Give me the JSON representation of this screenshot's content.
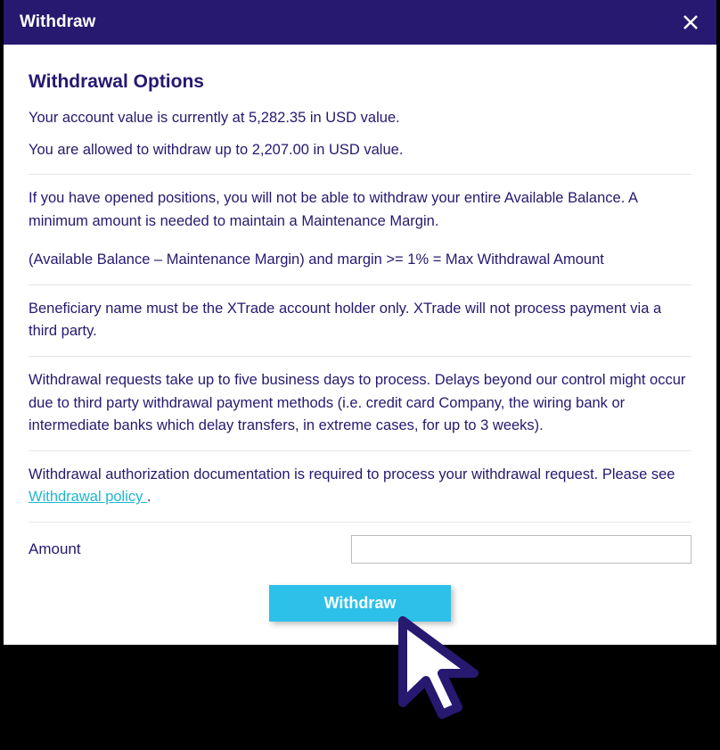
{
  "header": {
    "title": "Withdraw"
  },
  "body": {
    "section_title": "Withdrawal Options",
    "account_value_line": "Your account value is currently at 5,282.35 in USD value.",
    "allowed_line": "You are allowed to withdraw up to 2,207.00 in USD value.",
    "positions_para": "If you have opened positions, you will not be able to withdraw your entire Available Balance. A minimum amount is needed to maintain a Maintenance Margin.",
    "formula_para": "(Available Balance – Maintenance Margin) and margin >= 1% = Max Withdrawal Amount",
    "beneficiary_para": "Beneficiary name must be the XTrade account holder only. XTrade will not process payment via a third party.",
    "processing_para": "Withdrawal requests take up to five business days to process. Delays beyond our control might occur due to third party withdrawal payment methods (i.e. credit card Company, the wiring bank or intermediate banks which delay transfers, in extreme cases, for up to 3 weeks).",
    "auth_prefix": "Withdrawal authorization documentation is required to process your withdrawal request. Please see ",
    "auth_link": "Withdrawal policy ",
    "auth_suffix": ".",
    "amount_label": "Amount",
    "submit_label": "Withdraw"
  }
}
